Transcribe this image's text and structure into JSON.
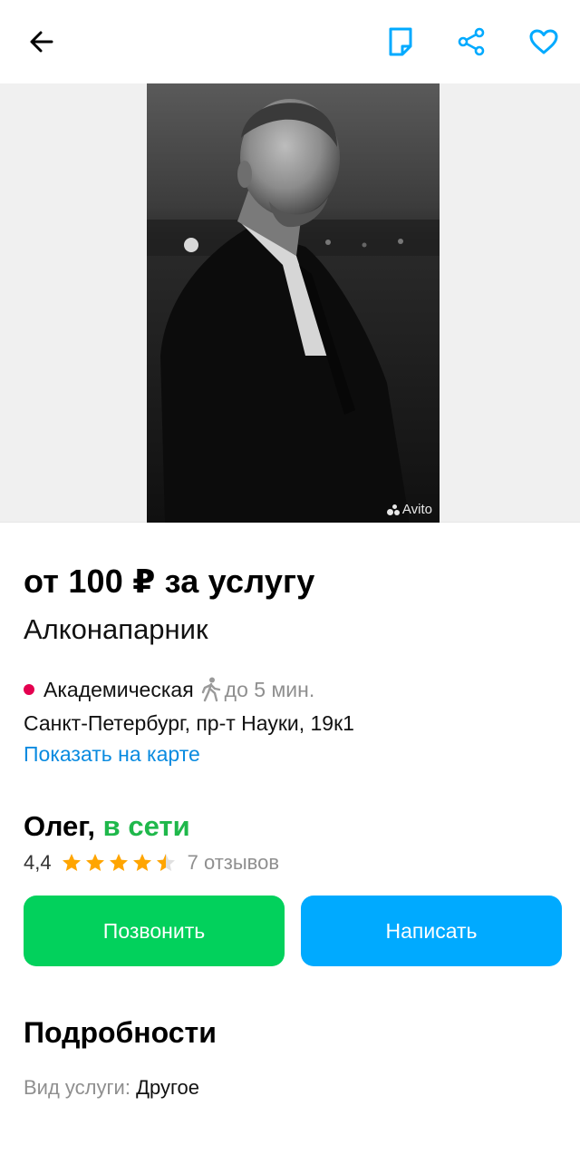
{
  "header": {
    "icons": [
      "back-arrow-icon",
      "note-icon",
      "share-icon",
      "heart-icon"
    ],
    "accent_color": "#00aaff"
  },
  "gallery": {
    "photo_subject": "portrait-photo",
    "watermark": "Avito"
  },
  "listing": {
    "price": "от 100 ₽ за услугу",
    "title": "Алконапарник"
  },
  "location": {
    "metro_station": "Академическая",
    "metro_color": "#e4004f",
    "walk_time": "до 5 мин.",
    "address": "Санкт-Петербург, пр-т Науки, 19к1",
    "map_link": "Показать на карте"
  },
  "seller": {
    "name": "Олег,",
    "status": "в сети",
    "status_color": "#1fb84b",
    "rating": "4,4",
    "stars_filled": 4.5,
    "stars_total": 5,
    "reviews": "7 отзывов"
  },
  "actions": {
    "call_label": "Позвонить",
    "call_color": "#02d15c",
    "write_label": "Написать",
    "write_color": "#00aaff"
  },
  "details": {
    "title": "Подробности",
    "items": [
      {
        "label": "Вид услуги:",
        "value": "Другое"
      }
    ]
  }
}
